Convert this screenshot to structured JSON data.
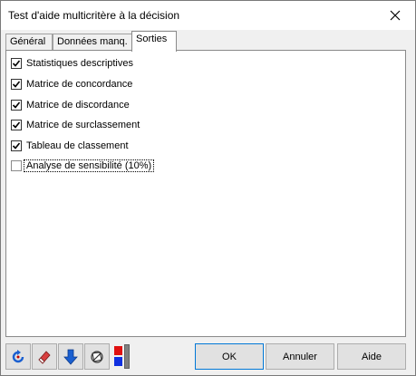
{
  "window": {
    "title": "Test d'aide multicritère à la décision"
  },
  "tabs": [
    {
      "label": "Général",
      "active": false
    },
    {
      "label": "Données manq.",
      "active": false
    },
    {
      "label": "Sorties",
      "active": true
    }
  ],
  "options": [
    {
      "label": "Statistiques descriptives",
      "checked": true
    },
    {
      "label": "Matrice de concordance",
      "checked": true
    },
    {
      "label": "Matrice de discordance",
      "checked": true
    },
    {
      "label": "Matrice de surclassement",
      "checked": true
    },
    {
      "label": "Tableau de classement",
      "checked": true
    },
    {
      "label": "Analyse de sensibilité (10%)",
      "checked": false
    }
  ],
  "toolbar": {
    "icons": [
      "reset-icon",
      "eraser-icon",
      "down-arrow-icon",
      "no-selection-icon"
    ],
    "colors": {
      "top": "#e01010",
      "bottom": "#1030e0",
      "bar": "#808080"
    }
  },
  "buttons": {
    "ok_label": "OK",
    "cancel_label": "Annuler",
    "help_label": "Aide"
  }
}
